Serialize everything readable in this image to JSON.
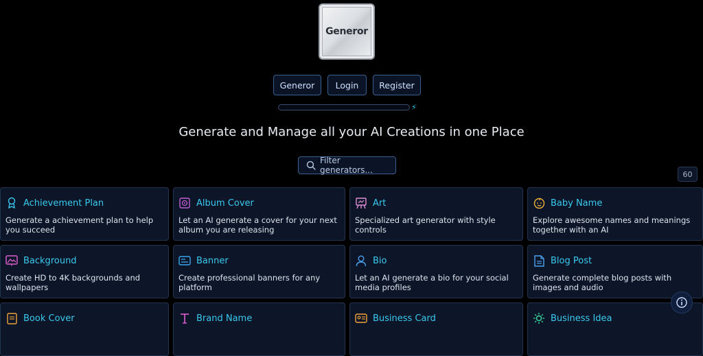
{
  "logo": {
    "text": "Generor"
  },
  "nav": [
    {
      "label": "Generor"
    },
    {
      "label": "Login"
    },
    {
      "label": "Register"
    }
  ],
  "progress": {
    "value": 0
  },
  "headline": "Generate and Manage all your AI Creations in one Place",
  "filter": {
    "placeholder": "Filter generators..."
  },
  "count": "60",
  "colors": {
    "accent": "#3ac9ee",
    "card_bg": "#0c1628",
    "card_border": "#22344f",
    "button_border": "#3d5f8e"
  },
  "cards": [
    {
      "icon": "ribbon-icon",
      "title": "Achievement Plan",
      "desc": "Generate a achievement plan to help you succeed"
    },
    {
      "icon": "album-icon",
      "title": "Album Cover",
      "desc": "Let an AI generate a cover for your next album you are releasing"
    },
    {
      "icon": "easel-icon",
      "title": "Art",
      "desc": "Specialized art generator with style controls"
    },
    {
      "icon": "baby-icon",
      "title": "Baby Name",
      "desc": "Explore awesome names and meanings together with an AI"
    },
    {
      "icon": "landscape-icon",
      "title": "Background",
      "desc": "Create HD to 4K backgrounds and wallpapers"
    },
    {
      "icon": "banner-icon",
      "title": "Banner",
      "desc": "Create professional banners for any platform"
    },
    {
      "icon": "user-icon",
      "title": "Bio",
      "desc": "Let an AI generate a bio for your social media profiles"
    },
    {
      "icon": "document-icon",
      "title": "Blog Post",
      "desc": "Generate complete blog posts with images and audio"
    },
    {
      "icon": "book-icon",
      "title": "Book Cover",
      "desc": ""
    },
    {
      "icon": "typography-icon",
      "title": "Brand Name",
      "desc": ""
    },
    {
      "icon": "id-card-icon",
      "title": "Business Card",
      "desc": ""
    },
    {
      "icon": "lightbulb-icon",
      "title": "Business Idea",
      "desc": ""
    }
  ]
}
